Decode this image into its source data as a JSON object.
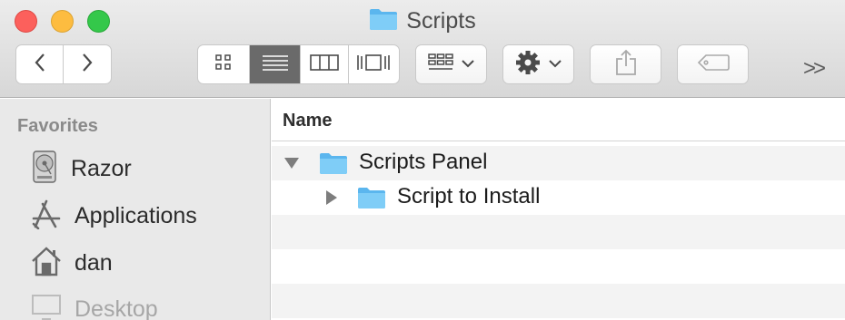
{
  "window": {
    "title": "Scripts"
  },
  "toolbar": {
    "back_icon": "chevron-left-icon",
    "forward_icon": "chevron-right-icon",
    "view_modes": [
      "icon-view",
      "list-view",
      "column-view",
      "cover-flow-view"
    ],
    "active_view": "list-view",
    "arrange_icon": "arrange-icon",
    "action_icon": "gear-icon",
    "share_icon": "share-icon",
    "tag_icon": "tag-icon",
    "overflow_label": ">>"
  },
  "sidebar": {
    "heading": "Favorites",
    "items": [
      {
        "label": "Razor",
        "icon": "hard-drive-icon"
      },
      {
        "label": "Applications",
        "icon": "applications-icon"
      },
      {
        "label": "dan",
        "icon": "home-icon"
      },
      {
        "label": "Desktop",
        "icon": "desktop-icon"
      }
    ]
  },
  "main": {
    "column_header": "Name",
    "rows": [
      {
        "label": "Scripts Panel",
        "expanded": true,
        "level": 0
      },
      {
        "label": "Script to Install",
        "expanded": false,
        "level": 1
      }
    ]
  },
  "colors": {
    "folder": "#6cc3f4",
    "active_segment": "#6a6a6a",
    "sidebar_bg": "#e9e9e9"
  }
}
